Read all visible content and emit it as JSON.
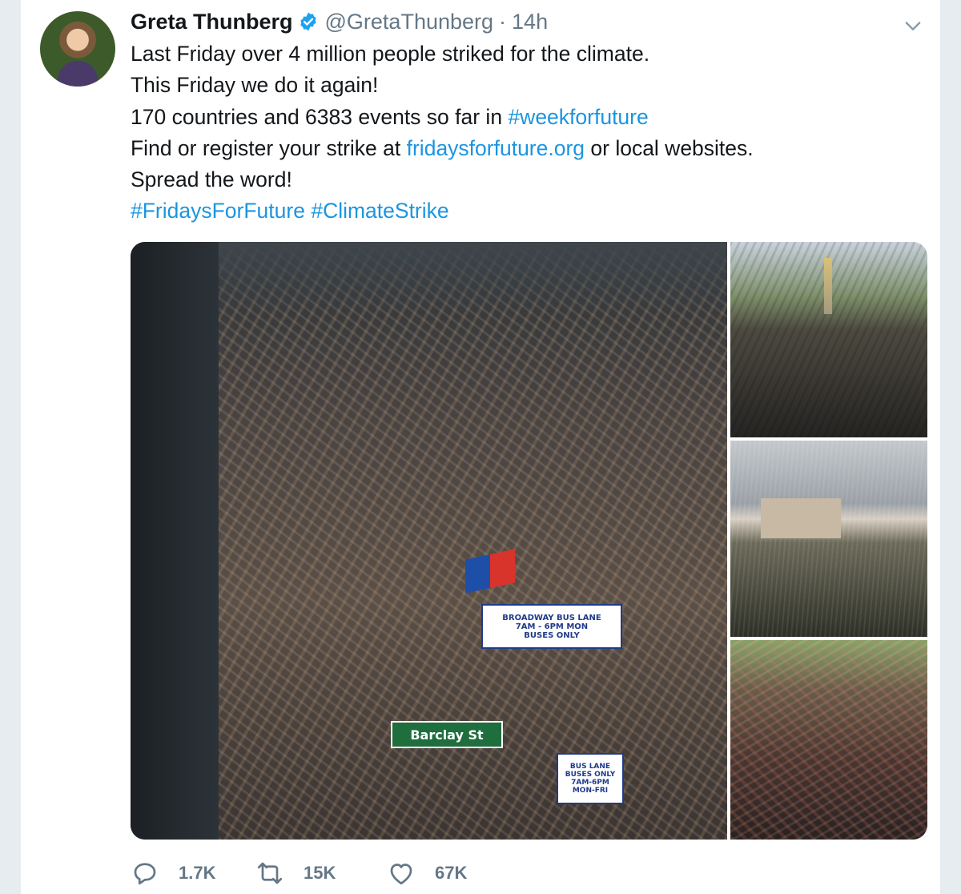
{
  "tweet": {
    "author_name": "Greta Thunberg",
    "handle": "@GretaThunberg",
    "separator": "·",
    "time": "14h",
    "lines": {
      "l1": "Last Friday over 4 million people striked for the climate.",
      "l2": "This Friday we do it again!",
      "l3_text": "170 countries and 6383 events so far in ",
      "l3_hashtag": "#weekforfuture",
      "l4_text_a": "Find or register your strike at ",
      "l4_link": "fridaysforfuture.org",
      "l4_text_b": " or local websites.",
      "l5": "Spread the word!",
      "l6_hashtag_a": "#FridaysForFuture",
      "l6_hashtag_b": "#ClimateStrike"
    }
  },
  "media": {
    "main_photo_signs": {
      "barclay": "Barclay St",
      "broadway_line1": "BROADWAY BUS LANE",
      "broadway_line2": "7AM - 6PM        MON",
      "broadway_line3": "BUSES ONLY",
      "buslane_line1": "BUS LANE",
      "buslane_line2": "BUSES ONLY",
      "buslane_line3": "7AM-6PM",
      "buslane_line4": "MON-FRI"
    }
  },
  "actions": {
    "replies": "1.7K",
    "retweets": "15K",
    "likes": "67K"
  },
  "icons": {
    "verified": "verified-badge-icon",
    "caret": "chevron-down-icon",
    "reply": "reply-icon",
    "retweet": "retweet-icon",
    "like": "heart-icon"
  },
  "colors": {
    "link": "#1b95e0",
    "text": "#14171a",
    "secondary": "#657786",
    "verified": "#1da1f2"
  }
}
